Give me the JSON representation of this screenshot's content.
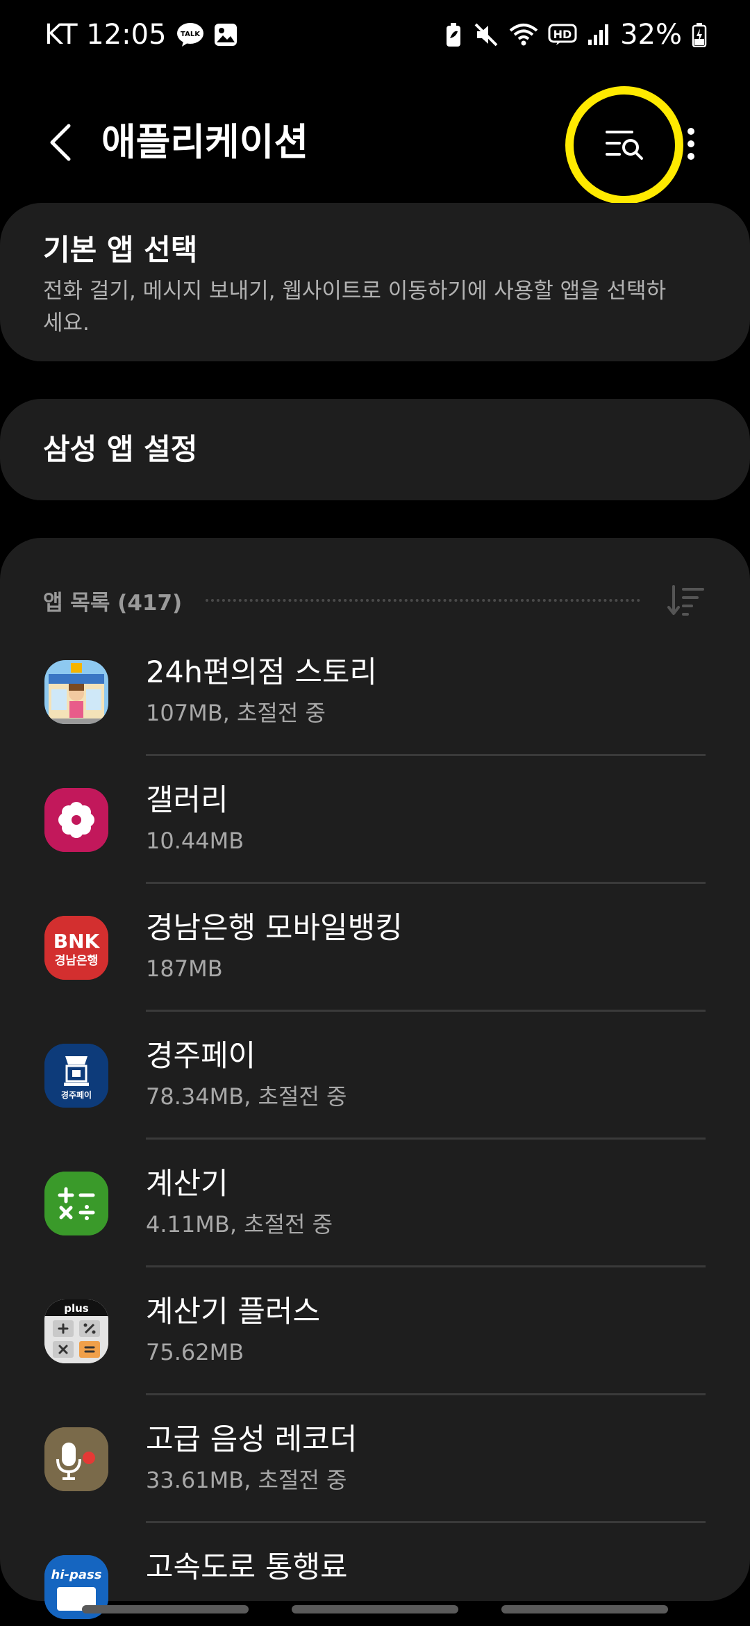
{
  "status_bar": {
    "carrier_time": "KT 12:05",
    "battery_percent": "32%",
    "network_badge": "HD",
    "icons": [
      "talk-icon",
      "gallery-notification-icon",
      "battery-saver-icon",
      "mute-icon",
      "wifi-icon",
      "hd-voice-icon",
      "signal-icon",
      "battery-charging-icon"
    ]
  },
  "app_bar": {
    "title": "애플리케이션",
    "back_icon": "back-arrow-icon",
    "search_icon": "filter-search-icon",
    "more_icon": "more-vert-icon",
    "highlight_color": "#ffea00"
  },
  "default_apps": {
    "title": "기본 앱 선택",
    "description": "전화 걸기, 메시지 보내기, 웹사이트로 이동하기에 사용할 앱을 선택하세요."
  },
  "samsung_apps": {
    "title": "삼성 앱 설정"
  },
  "app_list": {
    "header": "앱 목록 (417)",
    "sort_icon": "sort-icon",
    "items": [
      {
        "name": "24h편의점 스토리",
        "size": "107MB, 초절전 중",
        "icon": "convenience-store-game-icon"
      },
      {
        "name": "갤러리",
        "size": "10.44MB",
        "icon": "gallery-flower-icon",
        "color": "#c2185b"
      },
      {
        "name": "경남은행 모바일뱅킹",
        "size": "187MB",
        "icon": "bnk-bank-icon",
        "color": "#d32f2f",
        "icon_text": "BNK",
        "icon_subtext": "경남은행"
      },
      {
        "name": "경주페이",
        "size": "78.34MB, 초절전 중",
        "icon": "gyeongju-pay-icon",
        "color": "#0d3b7a",
        "icon_subtext": "경주페이"
      },
      {
        "name": "계산기",
        "size": "4.11MB, 초절전 중",
        "icon": "calculator-icon",
        "color": "#3a9a2a"
      },
      {
        "name": "계산기 플러스",
        "size": "75.62MB",
        "icon": "calculator-plus-icon",
        "icon_text": "plus"
      },
      {
        "name": "고급 음성 레코더",
        "size": "33.61MB, 초절전 중",
        "icon": "voice-recorder-icon",
        "color": "#7a6a4a"
      },
      {
        "name": "고속도로 통행료",
        "size": "",
        "icon": "hipass-icon",
        "color": "#1565c0",
        "icon_text": "hi-pass"
      }
    ]
  }
}
